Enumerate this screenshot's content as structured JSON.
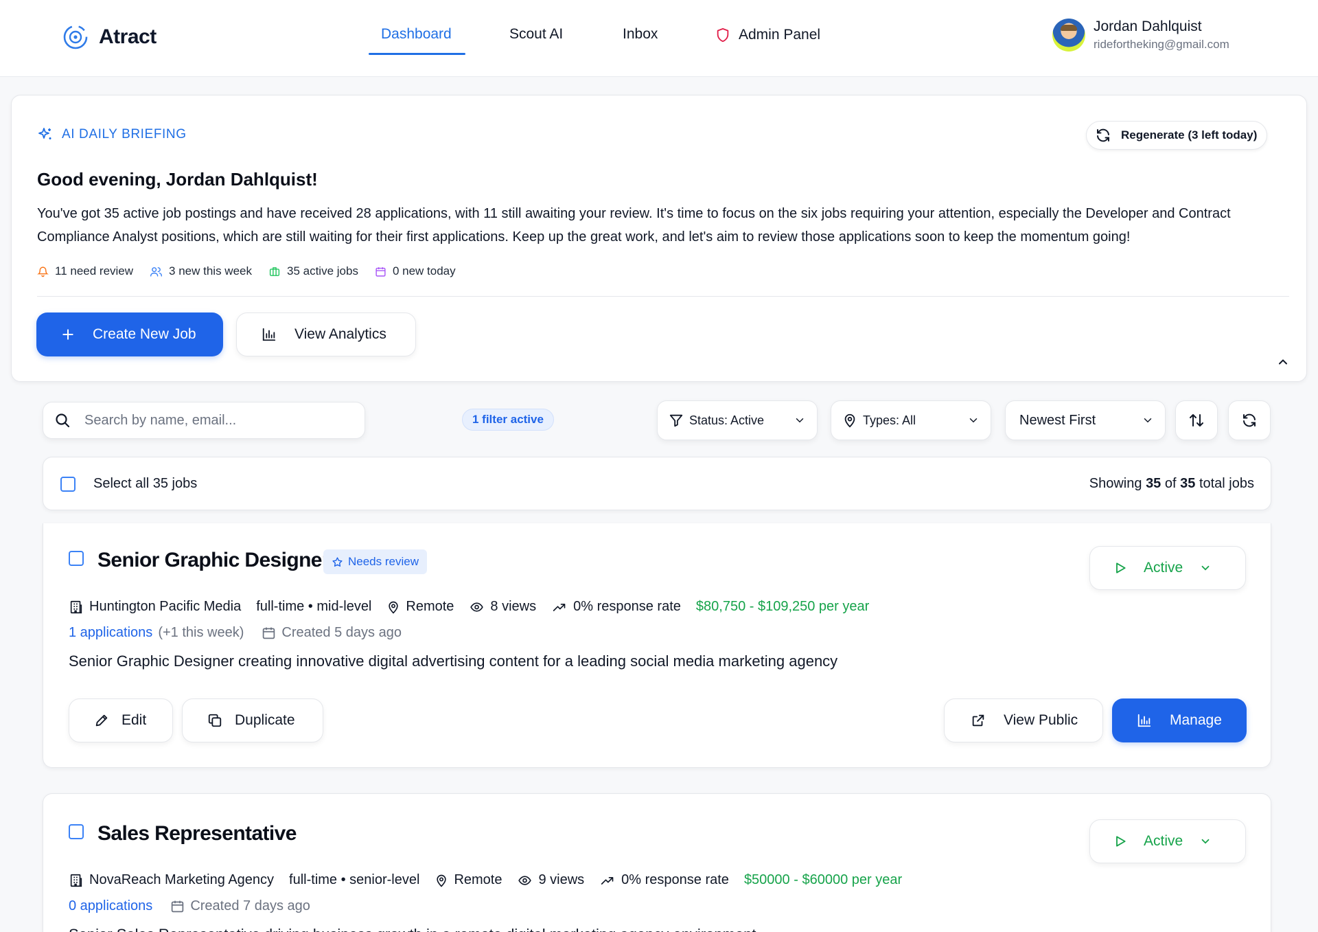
{
  "app": {
    "name": "Atract"
  },
  "nav": {
    "dashboard": "Dashboard",
    "scout": "Scout AI",
    "inbox": "Inbox",
    "admin": "Admin Panel"
  },
  "user": {
    "name": "Jordan Dahlquist",
    "email": "ridefortheking@gmail.com"
  },
  "briefing": {
    "label": "AI DAILY BRIEFING",
    "regenerate": "Regenerate (3 left today)",
    "greeting": "Good evening, Jordan Dahlquist!",
    "body": "You've got 35 active job postings and have received 28 applications, with 11 still awaiting your review. It's time to focus on the six jobs requiring your attention, especially the Developer and Contract Compliance Analyst positions, which are still waiting for their first applications. Keep up the great work, and let's aim to review those applications soon to keep the momentum going!",
    "stats": {
      "need_review": "11 need review",
      "new_week": "3 new this week",
      "active_jobs": "35 active jobs",
      "new_today": "0 new today"
    },
    "create_button": "Create New Job",
    "analytics_button": "View Analytics"
  },
  "filters": {
    "search_placeholder": "Search by name, email...",
    "active_badge": "1 filter active",
    "status": "Status: Active",
    "types": "Types: All",
    "sort": "Newest First"
  },
  "selection": {
    "select_all": "Select all 35 jobs",
    "showing_prefix": "Showing",
    "shown": "35",
    "of": "of",
    "total": "35",
    "suffix": "total jobs"
  },
  "jobs": [
    {
      "title": "Senior Graphic Designer",
      "badge": "Needs review",
      "status": "Active",
      "company": "Huntington Pacific Media",
      "type": "full-time • mid-level",
      "location": "Remote",
      "views": "8 views",
      "response": "0% response rate",
      "salary": "$80,750 - $109,250 per year",
      "applications": "1 applications",
      "applications_extra": "(+1 this week)",
      "created": "Created 5 days ago",
      "description": "Senior Graphic Designer creating innovative digital advertising content for a leading social media marketing agency",
      "edit": "Edit",
      "duplicate": "Duplicate",
      "view_public": "View Public",
      "manage": "Manage"
    },
    {
      "title": "Sales Representative",
      "status": "Active",
      "company": "NovaReach Marketing Agency",
      "type": "full-time • senior-level",
      "location": "Remote",
      "views": "9 views",
      "response": "0% response rate",
      "salary": "$50000 - $60000 per year",
      "applications": "0 applications",
      "created": "Created 7 days ago",
      "description": "Senior Sales Representative driving business growth in a remote digital marketing agency environment"
    }
  ],
  "colors": {
    "primary": "#1f64e8",
    "success": "#16a34a",
    "muted": "#6b7280"
  }
}
